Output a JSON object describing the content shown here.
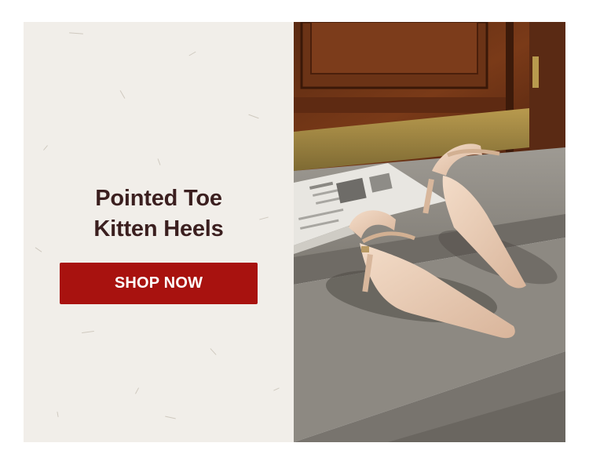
{
  "promo": {
    "headline_line1": "Pointed Toe",
    "headline_line2": "Kitten Heels",
    "cta_label": "SHOP NOW"
  },
  "colors": {
    "panel_background": "#f1eee9",
    "headline_text": "#3b1f1f",
    "cta_background": "#a8120f",
    "cta_text": "#ffffff"
  },
  "photo": {
    "subject": "nude-pointed-toe-kitten-heels-on-stone-steps",
    "icon": "product-photo"
  }
}
